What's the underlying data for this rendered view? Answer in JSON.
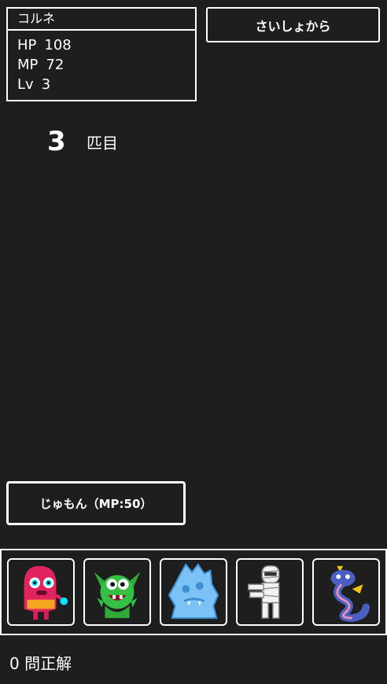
{
  "status": {
    "name": "コルネ",
    "hp_label": "HP",
    "hp_value": "108",
    "mp_label": "MP",
    "mp_value": "72",
    "lv_label": "Lv",
    "lv_value": "3"
  },
  "restart_button": "さいしょから",
  "counter": {
    "number": "3",
    "unit": "匹目"
  },
  "spell_button": "じゅもん（MP:50）",
  "monsters": [
    "red-blob-monster-icon",
    "green-goblin-monster-icon",
    "ice-golem-monster-icon",
    "mummy-monster-icon",
    "blue-dragon-monster-icon"
  ],
  "score_text": "0 問正解"
}
